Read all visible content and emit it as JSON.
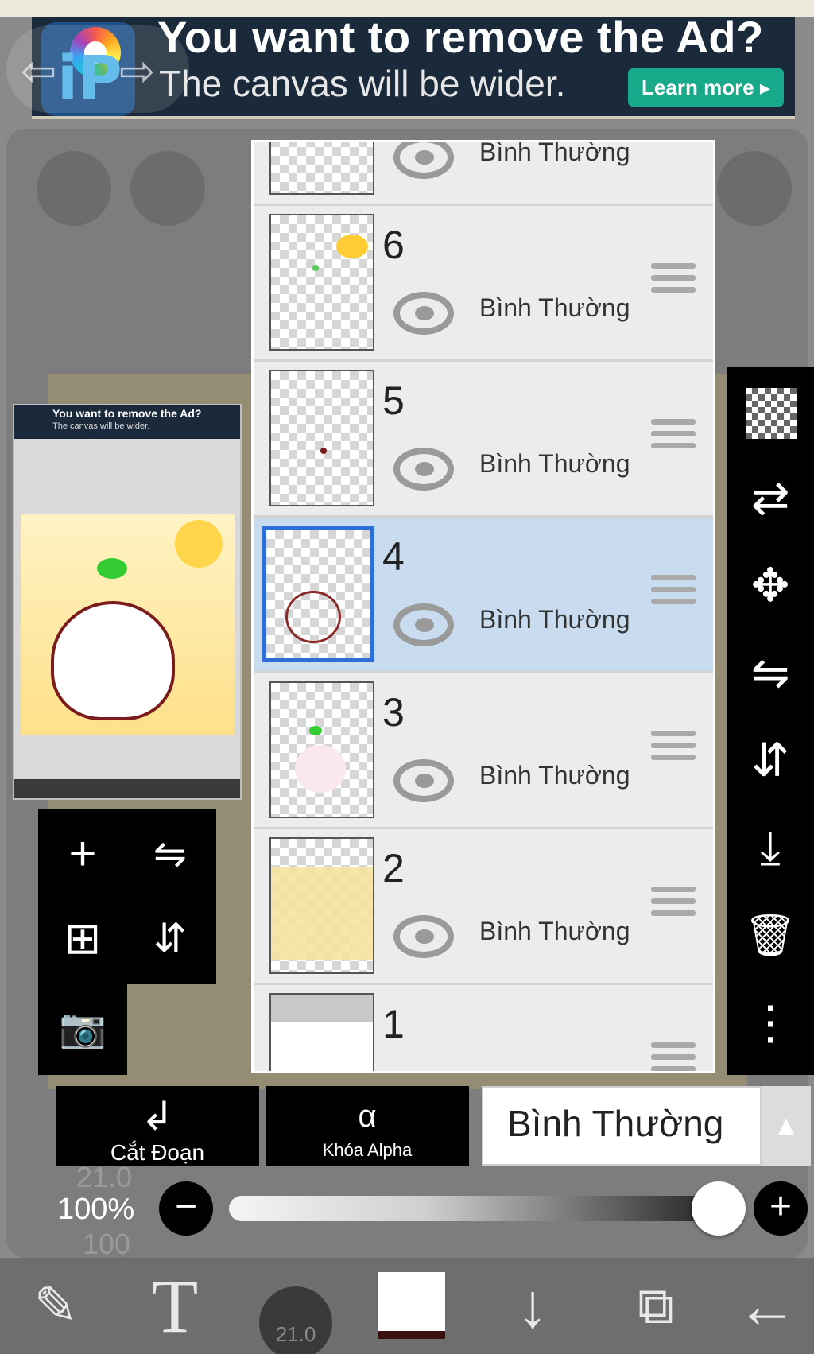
{
  "ad": {
    "title": "You want to remove the Ad?",
    "subtitle": "The canvas will be wider.",
    "button": "Learn more ▸",
    "logo_text": "iP"
  },
  "preview": {
    "ad_title": "You want to remove the Ad?",
    "ad_subtitle": "The canvas will be wider."
  },
  "layers": [
    {
      "number": "",
      "mode": "Bình Thường",
      "selected": false
    },
    {
      "number": "6",
      "mode": "Bình Thường",
      "selected": false
    },
    {
      "number": "5",
      "mode": "Bình Thường",
      "selected": false
    },
    {
      "number": "4",
      "mode": "Bình Thường",
      "selected": true
    },
    {
      "number": "3",
      "mode": "Bình Thường",
      "selected": false
    },
    {
      "number": "2",
      "mode": "Bình Thường",
      "selected": false
    },
    {
      "number": "1",
      "mode": "",
      "selected": false
    }
  ],
  "layer_actions": {
    "clip_label": "Cắt Đoạn",
    "alpha_lock_label": "Khóa Alpha",
    "alpha_lock_glyph": "α"
  },
  "blend_mode": {
    "selected": "Bình Thường",
    "arrow": "▲"
  },
  "opacity": {
    "label": "100%",
    "value_percent": 100,
    "minus": "−",
    "plus": "+",
    "ghost_brush_size": "21.0",
    "ghost_brush_opacity": "100"
  },
  "tool_panel": {
    "add": "+",
    "flip_h": "⇋",
    "add_copy": "⊞",
    "flip_v": "⇵",
    "camera": "📷"
  },
  "right_toolbar": {
    "transfer": "⇄",
    "move": "✥",
    "flip_h": "⇋",
    "flip_v": "⇵",
    "merge_down": "⤓",
    "delete": "🗑",
    "more": "⋮"
  },
  "bottom_toolbar": {
    "brush_size": "21.0",
    "text_tool": "T",
    "transform": "✎",
    "down_arrow": "↓",
    "layers": "⧉",
    "back": "←"
  },
  "colors": {
    "accent_blue": "#2d6fd6",
    "selected_row": "#c9dcef",
    "ad_green": "#18a88a",
    "panel_black": "#000000"
  }
}
